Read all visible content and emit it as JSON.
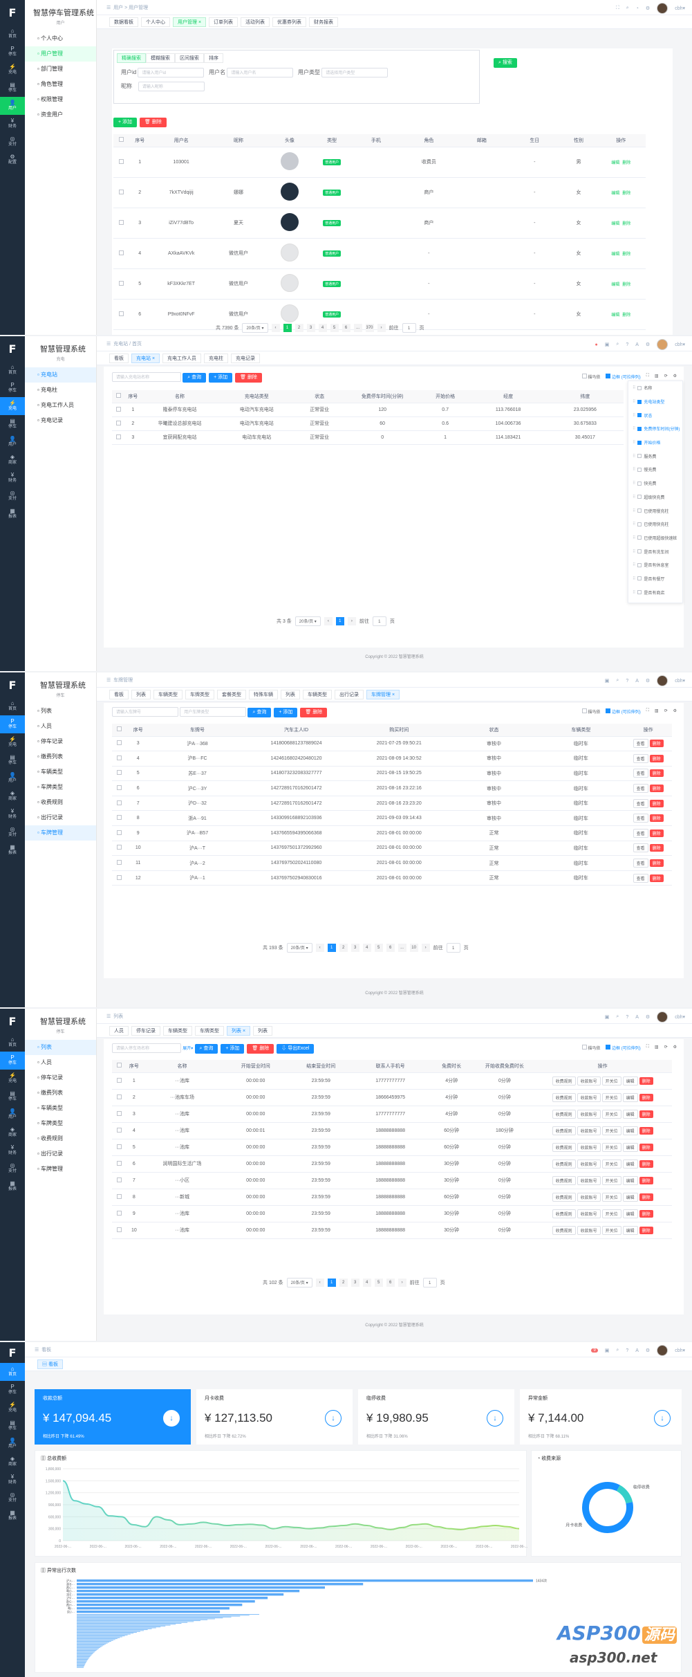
{
  "app": {
    "logo": "F",
    "title": "智慧停车管理系统",
    "sub_title": "用户"
  },
  "rail1": [
    {
      "icon": "⌂",
      "label": "首页"
    },
    {
      "icon": "P",
      "label": "停车"
    },
    {
      "icon": "⚡",
      "label": "充电"
    },
    {
      "icon": "▤",
      "label": "停车"
    },
    {
      "icon": "👤",
      "label": "用户"
    },
    {
      "icon": "¥",
      "label": "财务"
    },
    {
      "icon": "◎",
      "label": "支付"
    },
    {
      "icon": "⚙",
      "label": "配置"
    }
  ],
  "rail2": [
    {
      "icon": "⌂",
      "label": "首页"
    },
    {
      "icon": "P",
      "label": "停车"
    },
    {
      "icon": "⚡",
      "label": "充电"
    },
    {
      "icon": "▤",
      "label": "停车"
    },
    {
      "icon": "👤",
      "label": "用户"
    },
    {
      "icon": "◈",
      "label": "商家"
    },
    {
      "icon": "¥",
      "label": "财务"
    },
    {
      "icon": "◎",
      "label": "支付"
    },
    {
      "icon": "▦",
      "label": "报表"
    }
  ],
  "p1": {
    "sub_items": [
      "个人中心",
      "用户管理",
      "部门管理",
      "角色管理",
      "权限管理",
      "资金用户"
    ],
    "breadcrumb": [
      "用户",
      "用户管理"
    ],
    "tabs": [
      "数据看板",
      "个人中心",
      "用户管理",
      "订单列表",
      "活动列表",
      "优惠券列表",
      "财务报表"
    ],
    "filter_tabs": [
      "精确搜索",
      "模糊搜索",
      "区间搜索",
      "排序"
    ],
    "search": {
      "button": "搜索",
      "f_uid": "用户id",
      "ph_uid": "请输入用户id",
      "f_name": "用户名",
      "ph_name": "请输入用户名",
      "f_type": "用户类型",
      "ph_type": "请选择用户类型",
      "f_nick": "昵称",
      "ph_nick": "请输入昵称"
    },
    "add": "添加",
    "del": "删除",
    "columns": [
      "序号",
      "用户名",
      "昵称",
      "头像",
      "类型",
      "手机",
      "角色",
      "邮箱",
      "生日",
      "性别",
      "操作"
    ],
    "rows": [
      [
        "1",
        "103001",
        "",
        "",
        "普通用户",
        "",
        "收费员",
        "",
        "-",
        "男"
      ],
      [
        "2",
        "7kXTVdqijij",
        "娜娜",
        "",
        "普通用户",
        "",
        "商户",
        "",
        "-",
        "女"
      ],
      [
        "3",
        "iZiV77dBTo",
        "夏天",
        "",
        "普通用户",
        "",
        "商户",
        "",
        "-",
        "女"
      ],
      [
        "4",
        "AXkaAVKVk",
        "微信用户",
        "",
        "普通用户",
        "",
        "-",
        "",
        "-",
        "女"
      ],
      [
        "5",
        "kF3XKkr7ET",
        "微信用户",
        "",
        "普通用户",
        "",
        "-",
        "",
        "-",
        "女"
      ],
      [
        "6",
        "P9xot0NFvF",
        "微信用户",
        "",
        "普通用户",
        "",
        "-",
        "",
        "-",
        "女"
      ]
    ],
    "op_edit": "编辑",
    "op_del": "删除",
    "pager": {
      "total": "共 7390 条",
      "size": "20条/页",
      "pages": [
        "1",
        "2",
        "3",
        "4",
        "5",
        "6",
        "...",
        "370"
      ],
      "goto": "前往",
      "page": "1",
      "unit": "页"
    }
  },
  "p2": {
    "app_title": "智慧管理系统",
    "sub_title": "充电",
    "sub_items": [
      "充电站",
      "充电柱",
      "充电工作人员",
      "充电记录"
    ],
    "breadcrumb": [
      "充电站",
      "首页"
    ],
    "tabs": [
      "看板",
      "充电站",
      "充电工作人员",
      "充电柱",
      "充电记录"
    ],
    "search_ph": "请输入充电站名称",
    "btn_search": "查询",
    "btn_add": "添加",
    "btn_del": "删除",
    "checks": [
      "描马依",
      "边框 (可拉伸列)"
    ],
    "columns": [
      "序号",
      "名称",
      "充电站类型",
      "状态",
      "免费停车时间(分钟)",
      "开始价格",
      "经度",
      "纬度"
    ],
    "rows": [
      [
        "1",
        "隆泰停车充电站",
        "电动汽车充电站",
        "正常营业",
        "120",
        "0.7",
        "113.766018",
        "23.025956"
      ],
      [
        "2",
        "华曦建设总部充电站",
        "电动汽车充电站",
        "正常营业",
        "60",
        "0.6",
        "104.006736",
        "30.675833"
      ],
      [
        "3",
        "宜获网配充电站",
        "电动车充电站",
        "正常营业",
        "0",
        "1",
        "114.183421",
        "30.45017"
      ]
    ],
    "col_panel": [
      [
        "名称",
        false
      ],
      [
        "充电站类型",
        true
      ],
      [
        "状态",
        true
      ],
      [
        "免费停车时间(分钟)",
        true
      ],
      [
        "开始价格",
        true
      ],
      [
        "服务费",
        false
      ],
      [
        "慢充费",
        false
      ],
      [
        "快充费",
        false
      ],
      [
        "超级快充费",
        false
      ],
      [
        "已使用慢充柱",
        false
      ],
      [
        "已使用快充柱",
        false
      ],
      [
        "已使用超级快速桩",
        false
      ],
      [
        "是否有洗车间",
        false
      ],
      [
        "是否有休息室",
        false
      ],
      [
        "是否有餐厅",
        false
      ],
      [
        "是否有商店",
        false
      ]
    ],
    "pager": {
      "total": "共 3 条",
      "size": "20条/页",
      "page": "1",
      "goto": "前往",
      "unit": "页"
    },
    "copyright": "Copyright © 2022 智慧管理系统"
  },
  "p3": {
    "app_title": "智慧管理系统",
    "sub_title": "停车",
    "sub_items": [
      "列表",
      "人员",
      "停车记录",
      "缴费列表",
      "车辆类型",
      "车牌类型",
      "收费规则",
      "出行记录",
      "车牌管理"
    ],
    "breadcrumb": [
      "车牌管理"
    ],
    "tabs": [
      "看板",
      "列表",
      "车辆类型",
      "车牌类型",
      "套餐类型",
      "特殊车辆",
      "列表",
      "车辆类型",
      "出行记录",
      "车牌管理"
    ],
    "ph1": "请输入车牌号",
    "ph2": "用户车牌类型",
    "btn_search": "查询",
    "btn_add": "添加",
    "btn_del": "删除",
    "checks": [
      "描马依",
      "边框 (可拉伸列)"
    ],
    "columns": [
      "序号",
      "车牌号",
      "汽车主人ID",
      "购买时间",
      "状态",
      "车辆类型",
      "操作"
    ],
    "rows": [
      [
        "3",
        "沪A···368",
        "1418006881237889024",
        "2021-07-25 09:50:21",
        "审核中",
        "临时车"
      ],
      [
        "4",
        "沪B···FC",
        "1424616802420480120",
        "2021-08-09 14:30:52",
        "审核中",
        "临时车"
      ],
      [
        "5",
        "苏E···37",
        "1418073232083327777",
        "2021-08-15 19:50:25",
        "审核中",
        "临时车"
      ],
      [
        "6",
        "沪C···3Y",
        "1427289170162601472",
        "2021-08-16 23:22:16",
        "审核中",
        "临时车"
      ],
      [
        "7",
        "沪D···32",
        "1427289170162601472",
        "2021-08-16 23:23:20",
        "审核中",
        "临时车"
      ],
      [
        "8",
        "浙A···91",
        "1433099168892103936",
        "2021-09-03 09:14:43",
        "审核中",
        "临时车"
      ],
      [
        "9",
        "沪A···B57",
        "1437665594395066368",
        "2021-08-01 00:00:00",
        "正常",
        "临时车"
      ],
      [
        "10",
        "沪A···T",
        "1437697501372992960",
        "2021-08-01 00:00:00",
        "正常",
        "临时车"
      ],
      [
        "11",
        "沪A···2",
        "1437697502024110080",
        "2021-08-01 00:00:00",
        "正常",
        "临时车"
      ],
      [
        "12",
        "沪A···1",
        "1437697502940830016",
        "2021-08-01 00:00:00",
        "正常",
        "临时车"
      ]
    ],
    "op_view": "查看",
    "op_del": "删除",
    "pager": {
      "total": "共 193 条",
      "size": "20条/页",
      "pages": [
        "1",
        "2",
        "3",
        "4",
        "5",
        "6",
        "...",
        "10"
      ],
      "goto": "前往",
      "page": "1",
      "unit": "页"
    },
    "copyright": "Copyright © 2022 智慧管理系统"
  },
  "p4": {
    "app_title": "智慧管理系统",
    "sub_title": "停车",
    "sub_items": [
      "列表",
      "人员",
      "停车记录",
      "缴费列表",
      "车辆类型",
      "车牌类型",
      "收费规则",
      "出行记录",
      "车牌管理"
    ],
    "breadcrumb": [
      "列表"
    ],
    "tabs": [
      "人员",
      "停车记录",
      "车辆类型",
      "车牌类型",
      "列表",
      "列表"
    ],
    "ph": "请输入停车场名称",
    "expand": "展开",
    "btn_search": "查询",
    "btn_add": "添加",
    "btn_del": "删除",
    "btn_export": "导出Excel",
    "checks": [
      "描马依",
      "边框 (可拉伸列)"
    ],
    "columns": [
      "序号",
      "名称",
      "开始营业时间",
      "结束营业时间",
      "联系人手机号",
      "免费时长",
      "开始收费免费时长",
      "操作"
    ],
    "rows": [
      [
        "1",
        "···池库",
        "00:00:00",
        "23:59:59",
        "17777777777",
        "4分钟",
        "0分钟"
      ],
      [
        "2",
        "···池库车场",
        "00:00:00",
        "23:59:59",
        "18666459975",
        "4分钟",
        "0分钟"
      ],
      [
        "3",
        "···池库",
        "00:00:00",
        "23:59:59",
        "17777777777",
        "4分钟",
        "0分钟"
      ],
      [
        "4",
        "···池库",
        "00:00:01",
        "23:59:59",
        "18888888888",
        "60分钟",
        "180分钟"
      ],
      [
        "5",
        "···池库",
        "00:00:00",
        "23:59:59",
        "18888888888",
        "60分钟",
        "0分钟"
      ],
      [
        "6",
        "润明国际生活广场",
        "00:00:00",
        "23:59:59",
        "18888888888",
        "30分钟",
        "0分钟"
      ],
      [
        "7",
        "···小区",
        "00:00:00",
        "23:59:59",
        "18888888888",
        "30分钟",
        "0分钟"
      ],
      [
        "8",
        "···新城",
        "00:00:00",
        "23:59:59",
        "18888888888",
        "60分钟",
        "0分钟"
      ],
      [
        "9",
        "···池库",
        "00:00:00",
        "23:59:59",
        "18888888888",
        "30分钟",
        "0分钟"
      ],
      [
        "10",
        "···池库",
        "00:00:00",
        "23:59:59",
        "18888888888",
        "30分钟",
        "0分钟"
      ]
    ],
    "ops": [
      "收费规则",
      "收款账号",
      "开关位",
      "编辑",
      "删除"
    ],
    "pager": {
      "total": "共 102 条",
      "size": "20条/页",
      "pages": [
        "1",
        "2",
        "3",
        "4",
        "5",
        "6"
      ],
      "goto": "前往",
      "page": "1",
      "unit": "页"
    },
    "copyright": "Copyright © 2022 智慧管理系统"
  },
  "p5": {
    "breadcrumb": [
      "看板"
    ],
    "tab": "看板",
    "badge": "9",
    "cards": [
      {
        "label": "收款总额",
        "value": "¥ 147,094.45",
        "note": "相比昨日 下降 61.49%"
      },
      {
        "label": "月卡收费",
        "value": "¥ 127,113.50",
        "note": "相比昨日 下降 62.72%"
      },
      {
        "label": "临停收费",
        "value": "¥ 19,980.95",
        "note": "相比昨日 下降 31.06%"
      },
      {
        "label": "异常金额",
        "value": "¥ 7,144.00",
        "note": "相比昨日 下降 68.11%"
      }
    ],
    "trend_title": "总收费额",
    "pie_title": "收费来源",
    "rank_title": "异常出行次数",
    "rank_top": "1434次",
    "watermark": "ASP300",
    "watermark2": "源码",
    "watermark_url": "asp300.net"
  },
  "chart_data": [
    {
      "type": "area",
      "title": "总收费额",
      "y_ticks": [
        "1,800,000",
        "1,500,000",
        "1,200,000",
        "900,000",
        "600,000",
        "300,000",
        "0"
      ],
      "ylim": [
        0,
        1800000
      ],
      "x_labels": [
        "2022-06-...",
        "2022-06-...",
        "2022-06-...",
        "2022-06-...",
        "2022-06-...",
        "2022-06-...",
        "2022-06-...",
        "2022-06-...",
        "2022-06-...",
        "2022-06-...",
        "2022-06-...",
        "2022-06-...",
        "2022-06-...",
        "2022-06-..."
      ],
      "series": [
        {
          "name": "总收费额",
          "values": [
            1500000,
            1000000,
            920000,
            850000,
            620000,
            600000,
            400000,
            350000,
            600000,
            520000,
            400000,
            420000,
            460000,
            420000,
            380000,
            400000,
            410000,
            390000,
            300000,
            350000,
            330000,
            300000,
            320000,
            360000,
            380000,
            420000,
            380000,
            320000,
            280000,
            330000,
            400000,
            420000,
            350000,
            300000,
            280000,
            320000,
            360000,
            380000,
            350000,
            300000
          ]
        }
      ]
    },
    {
      "type": "pie",
      "title": "收费来源",
      "series": [
        {
          "name": "收费来源",
          "values": [
            {
              "label": "临停收费",
              "value": 19980.95
            },
            {
              "label": "月卡收费",
              "value": 127113.5
            }
          ]
        }
      ]
    },
    {
      "type": "bar",
      "title": "异常出行次数",
      "categories": [
        "沪A···",
        "浙B···",
        "苏C···",
        "粤D···",
        "京E···",
        "沪F···",
        "浙G···",
        "苏H···",
        "粤I···",
        "京J···"
      ],
      "values": [
        1434,
        900,
        780,
        700,
        650,
        600,
        560,
        520,
        480,
        450
      ]
    }
  ]
}
